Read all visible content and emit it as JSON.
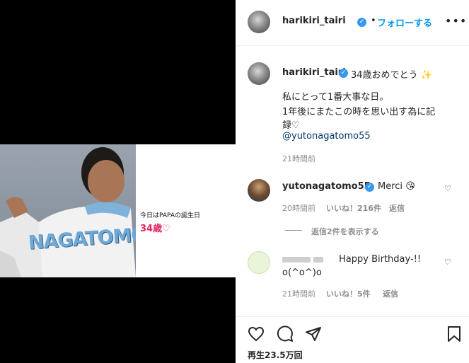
{
  "post": {
    "owner": "harikiri_tairi",
    "follow_label": "フォロー",
    "follow_action": "する",
    "dot": "•",
    "more": "•••"
  },
  "media": {
    "caption_line1": "今日はPAPAの誕生日",
    "caption_line2": "34歳",
    "caption_heart": "♡",
    "jersey_name": "NAGATOMO"
  },
  "caption": {
    "username": "harikiri_tairi",
    "line1": "34歳おめでとう",
    "line1_emoji": "✨",
    "line2": "私にとって1番大事な日。",
    "line3": "1年後にまたこの時を思い出す為に記",
    "line4": "録♡",
    "mention": "@yutonagatomo55",
    "time": "21時間前"
  },
  "comments": [
    {
      "username": "yutonagatomo55",
      "text": "Merci",
      "emoji": "😘",
      "time": "20時間前",
      "likes": "いいね！216件",
      "reply": "返信"
    },
    {
      "username": "",
      "text": "Happy Birthday-!!",
      "text2": "o(^o^)o",
      "time": "21時間前",
      "likes": "いいね！5件",
      "reply": "返信"
    }
  ],
  "view_replies": "返信2件を表示する",
  "views": "再生23.5万回",
  "icons": {
    "like": "heart-outline-icon",
    "comment": "speech-bubble-icon",
    "share": "paper-plane-icon",
    "save": "bookmark-icon",
    "verified": "verified-badge-icon"
  },
  "colors": {
    "accent": "#0095f6",
    "verified": "#3897f0",
    "caption_red": "#e0245e"
  }
}
